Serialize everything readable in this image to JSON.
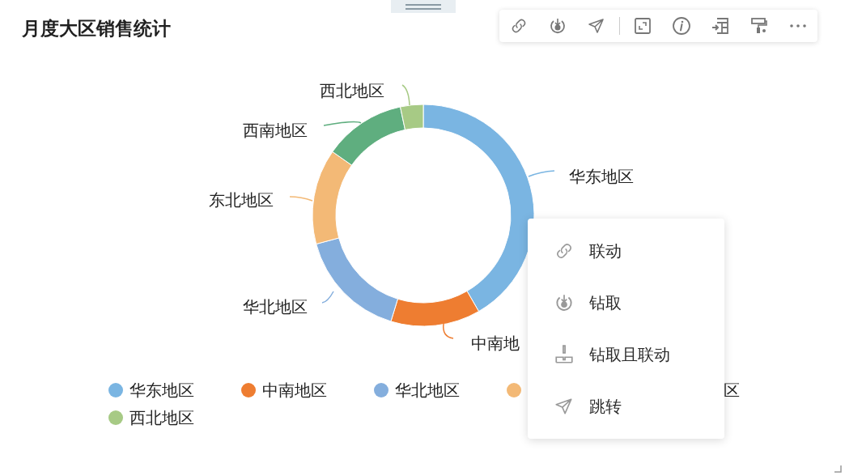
{
  "title": "月度大区销售统计",
  "slices": [
    {
      "name": "华东地区",
      "color": "#7ab5e2"
    },
    {
      "name": "中南地",
      "color": "#ee7d31"
    },
    {
      "name": "华北地区",
      "color": "#84aedd"
    },
    {
      "name": "东北地区",
      "color": "#f3b976"
    },
    {
      "name": "西南地区",
      "color": "#5fae7f"
    },
    {
      "name": "西北地区",
      "color": "#a7ca85"
    }
  ],
  "legend": [
    {
      "name": "华东地区",
      "color": "#7ab5e2"
    },
    {
      "name": "中南地区",
      "color": "#ee7d31"
    },
    {
      "name": "华北地区",
      "color": "#84aedd"
    },
    {
      "color": "#f3b976"
    },
    {
      "name": "区"
    },
    {
      "name": "西北地区",
      "color": "#a7ca85"
    }
  ],
  "context_menu": [
    {
      "kind": "link",
      "label": "联动"
    },
    {
      "kind": "drill",
      "label": "钻取"
    },
    {
      "kind": "drill-link",
      "label": "钻取且联动"
    },
    {
      "kind": "jump",
      "label": "跳转"
    }
  ]
}
